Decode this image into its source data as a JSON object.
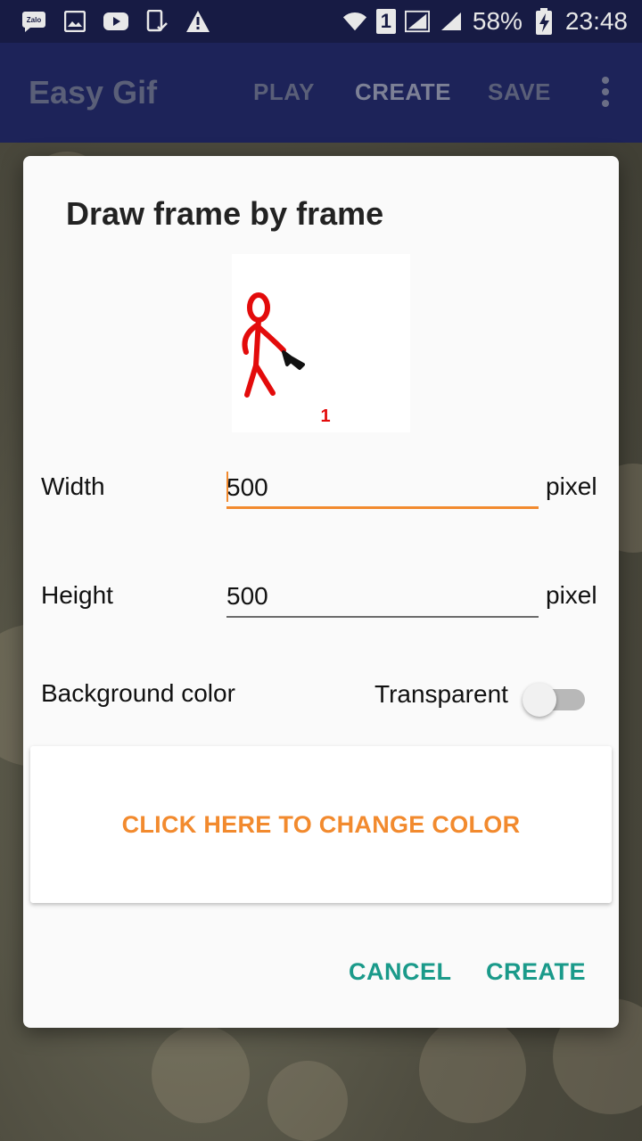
{
  "status_bar": {
    "icons": [
      "zalo-icon",
      "gallery-icon",
      "youtube-icon",
      "device-check-icon",
      "warning-icon"
    ],
    "zalo_label": "Zalo",
    "sim_label": "1",
    "battery": "58%",
    "time": "23:48"
  },
  "app_bar": {
    "title": "Easy Gif",
    "play_label": "PLAY",
    "create_label": "CREATE",
    "save_label": "SAVE"
  },
  "dialog": {
    "title": "Draw frame by frame",
    "preview_frame_number": "1",
    "width_label": "Width",
    "width_value": "500",
    "height_label": "Height",
    "height_value": "500",
    "unit": "pixel",
    "bg_color_label": "Background color",
    "transparent_label": "Transparent",
    "transparent_on": false,
    "change_color_label": "CLICK HERE TO CHANGE COLOR",
    "cancel_label": "CANCEL",
    "create_label": "CREATE"
  },
  "colors": {
    "status_bar": "#171b44",
    "app_bar": "#1d2359",
    "accent": "#f28a2e",
    "dialog_button": "#1a9a8a"
  }
}
